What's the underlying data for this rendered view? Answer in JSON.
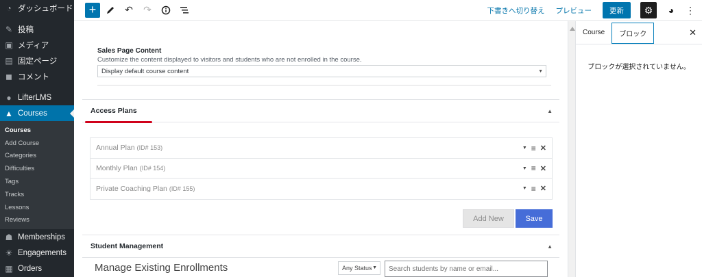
{
  "sidebar": {
    "dashboard": "ダッシュボード",
    "posts": "投稿",
    "media": "メディア",
    "pages": "固定ページ",
    "comments": "コメント",
    "lifterlms": "LifterLMS",
    "courses": "Courses",
    "submenu": [
      "Courses",
      "Add Course",
      "Categories",
      "Difficulties",
      "Tags",
      "Tracks",
      "Lessons",
      "Reviews"
    ],
    "memberships": "Memberships",
    "engagements": "Engagements",
    "orders": "Orders"
  },
  "toolbar": {
    "switch_draft": "下書きへ切り替え",
    "preview": "プレビュー",
    "update": "更新"
  },
  "sales_page": {
    "title": "Sales Page Content",
    "description": "Customize the content displayed to visitors and students who are not enrolled in the course.",
    "selected": "Display default course content"
  },
  "access_plans": {
    "title": "Access Plans",
    "plans": [
      {
        "name": "Annual Plan",
        "id": "(ID# 153)"
      },
      {
        "name": "Monthly Plan",
        "id": "(ID# 154)"
      },
      {
        "name": "Private Coaching Plan",
        "id": "(ID# 155)"
      }
    ],
    "add_new": "Add New",
    "save": "Save"
  },
  "student_management": {
    "title": "Student Management",
    "manage_heading": "Manage Existing Enrollments",
    "status_filter": "Any Status",
    "search_placeholder": "Search students by name or email..."
  },
  "panel": {
    "tab_course": "Course",
    "tab_block": "ブロック",
    "no_block": "ブロックが選択されていません。"
  }
}
